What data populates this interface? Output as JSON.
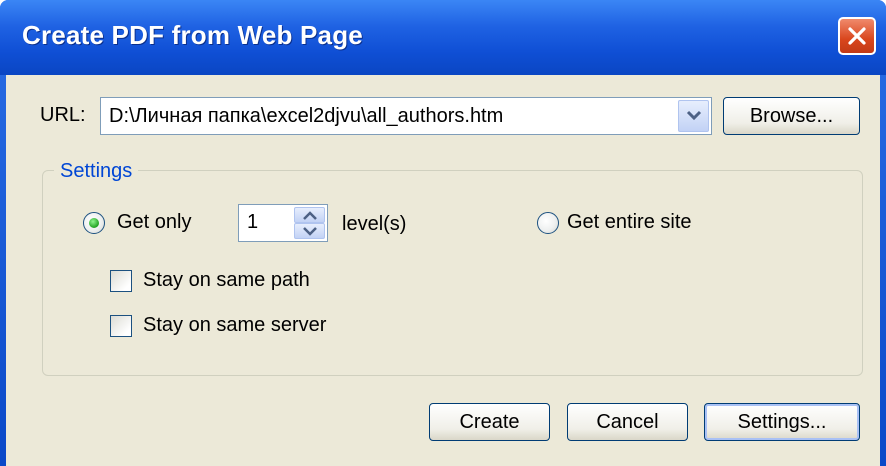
{
  "window": {
    "title": "Create PDF from Web Page"
  },
  "url": {
    "label": "URL:",
    "value": "D:\\Личная папка\\excel2djvu\\all_authors.htm",
    "browse_label": "Browse..."
  },
  "settings_group": {
    "title": "Settings",
    "get_only_label": "Get only",
    "get_only_selected": true,
    "levels_value": "1",
    "levels_unit": "level(s)",
    "entire_site_label": "Get entire site",
    "entire_site_selected": false,
    "same_path_label": "Stay on same path",
    "same_path_checked": false,
    "same_server_label": "Stay on same server",
    "same_server_checked": false
  },
  "buttons": {
    "create": "Create",
    "cancel": "Cancel",
    "settings": "Settings..."
  },
  "colors": {
    "title_bar": "#0a46c3",
    "close_button": "#d9461d",
    "face": "#ece9d8",
    "group_title": "#0046d5",
    "radio_dot": "#21a121"
  }
}
